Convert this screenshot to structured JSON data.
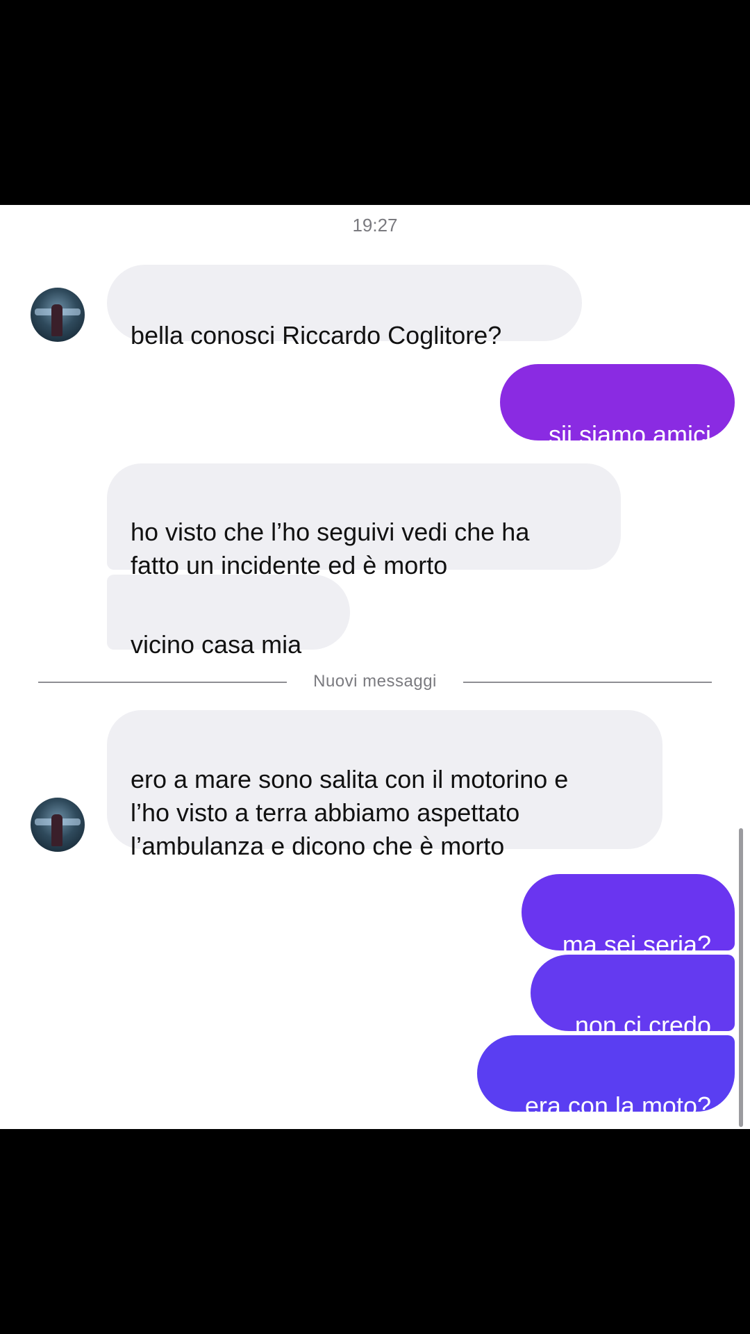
{
  "chat": {
    "timestamp": "19:27",
    "divider_label": "Nuovi messaggi",
    "messages": [
      {
        "side": "in",
        "text": "bella conosci Riccardo Coglitore?"
      },
      {
        "side": "out",
        "text": "sii,siamo amici"
      },
      {
        "side": "in",
        "text": "ho visto che l’ho seguivi vedi che ha\nfatto un incidente ed è morto"
      },
      {
        "side": "in",
        "text": "vicino casa mia"
      },
      {
        "side": "in",
        "text": "ero a mare sono salita con il motorino e\nl’ho visto a terra abbiamo aspettato\nl’ambulanza e dicono che è morto"
      },
      {
        "side": "out",
        "text": "ma sei seria?"
      },
      {
        "side": "out",
        "text": "non ci credo"
      },
      {
        "side": "out",
        "text": "era con la moto?"
      }
    ]
  },
  "colors": {
    "incoming_bubble": "#efeff3",
    "outgoing_purple": "#8a2be2",
    "outgoing_violet": "#6a35f0",
    "outgoing_indigo": "#5a3ef2"
  },
  "icons": {
    "avatar": "profile-photo"
  }
}
